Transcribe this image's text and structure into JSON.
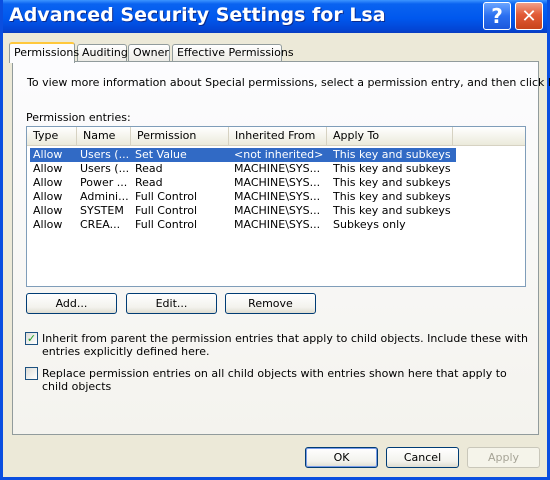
{
  "window": {
    "title": "Advanced Security Settings for Lsa"
  },
  "titlebar": {
    "help_glyph": "?",
    "close_glyph": "✕"
  },
  "tabs": [
    {
      "label": "Permissions",
      "active": true
    },
    {
      "label": "Auditing",
      "active": false
    },
    {
      "label": "Owner",
      "active": false
    },
    {
      "label": "Effective Permissions",
      "active": false
    }
  ],
  "permissions": {
    "info_text": "To view more information about Special permissions, select a permission entry, and then click Edit.",
    "entries_label": "Permission entries:",
    "columns": [
      "Type",
      "Name",
      "Permission",
      "Inherited From",
      "Apply To"
    ],
    "rows": [
      {
        "type": "Allow",
        "name": "Users (...",
        "permission": "Set Value",
        "inherited": "<not inherited>",
        "apply_to": "This key and subkeys",
        "selected": true
      },
      {
        "type": "Allow",
        "name": "Users (...",
        "permission": "Read",
        "inherited": "MACHINE\\SYS...",
        "apply_to": "This key and subkeys",
        "selected": false
      },
      {
        "type": "Allow",
        "name": "Power ...",
        "permission": "Read",
        "inherited": "MACHINE\\SYS...",
        "apply_to": "This key and subkeys",
        "selected": false
      },
      {
        "type": "Allow",
        "name": "Admini...",
        "permission": "Full Control",
        "inherited": "MACHINE\\SYS...",
        "apply_to": "This key and subkeys",
        "selected": false
      },
      {
        "type": "Allow",
        "name": "SYSTEM",
        "permission": "Full Control",
        "inherited": "MACHINE\\SYS...",
        "apply_to": "This key and subkeys",
        "selected": false
      },
      {
        "type": "Allow",
        "name": "CREA...",
        "permission": "Full Control",
        "inherited": "MACHINE\\SYS...",
        "apply_to": "Subkeys only",
        "selected": false
      }
    ],
    "buttons": {
      "add": "Add...",
      "edit": "Edit...",
      "remove": "Remove"
    },
    "inherit_checkbox": {
      "label": "Inherit from parent the permission entries that apply to child objects. Include these with entries explicitly defined here.",
      "checked": true
    },
    "replace_checkbox": {
      "label": "Replace permission entries on all child objects with entries shown here that apply to child objects",
      "checked": false
    }
  },
  "footer": {
    "ok": "OK",
    "cancel": "Cancel",
    "apply": "Apply"
  },
  "colors": {
    "titlebar": "#0058ee",
    "selection": "#316ac5",
    "dialog_bg": "#ece9d8"
  }
}
